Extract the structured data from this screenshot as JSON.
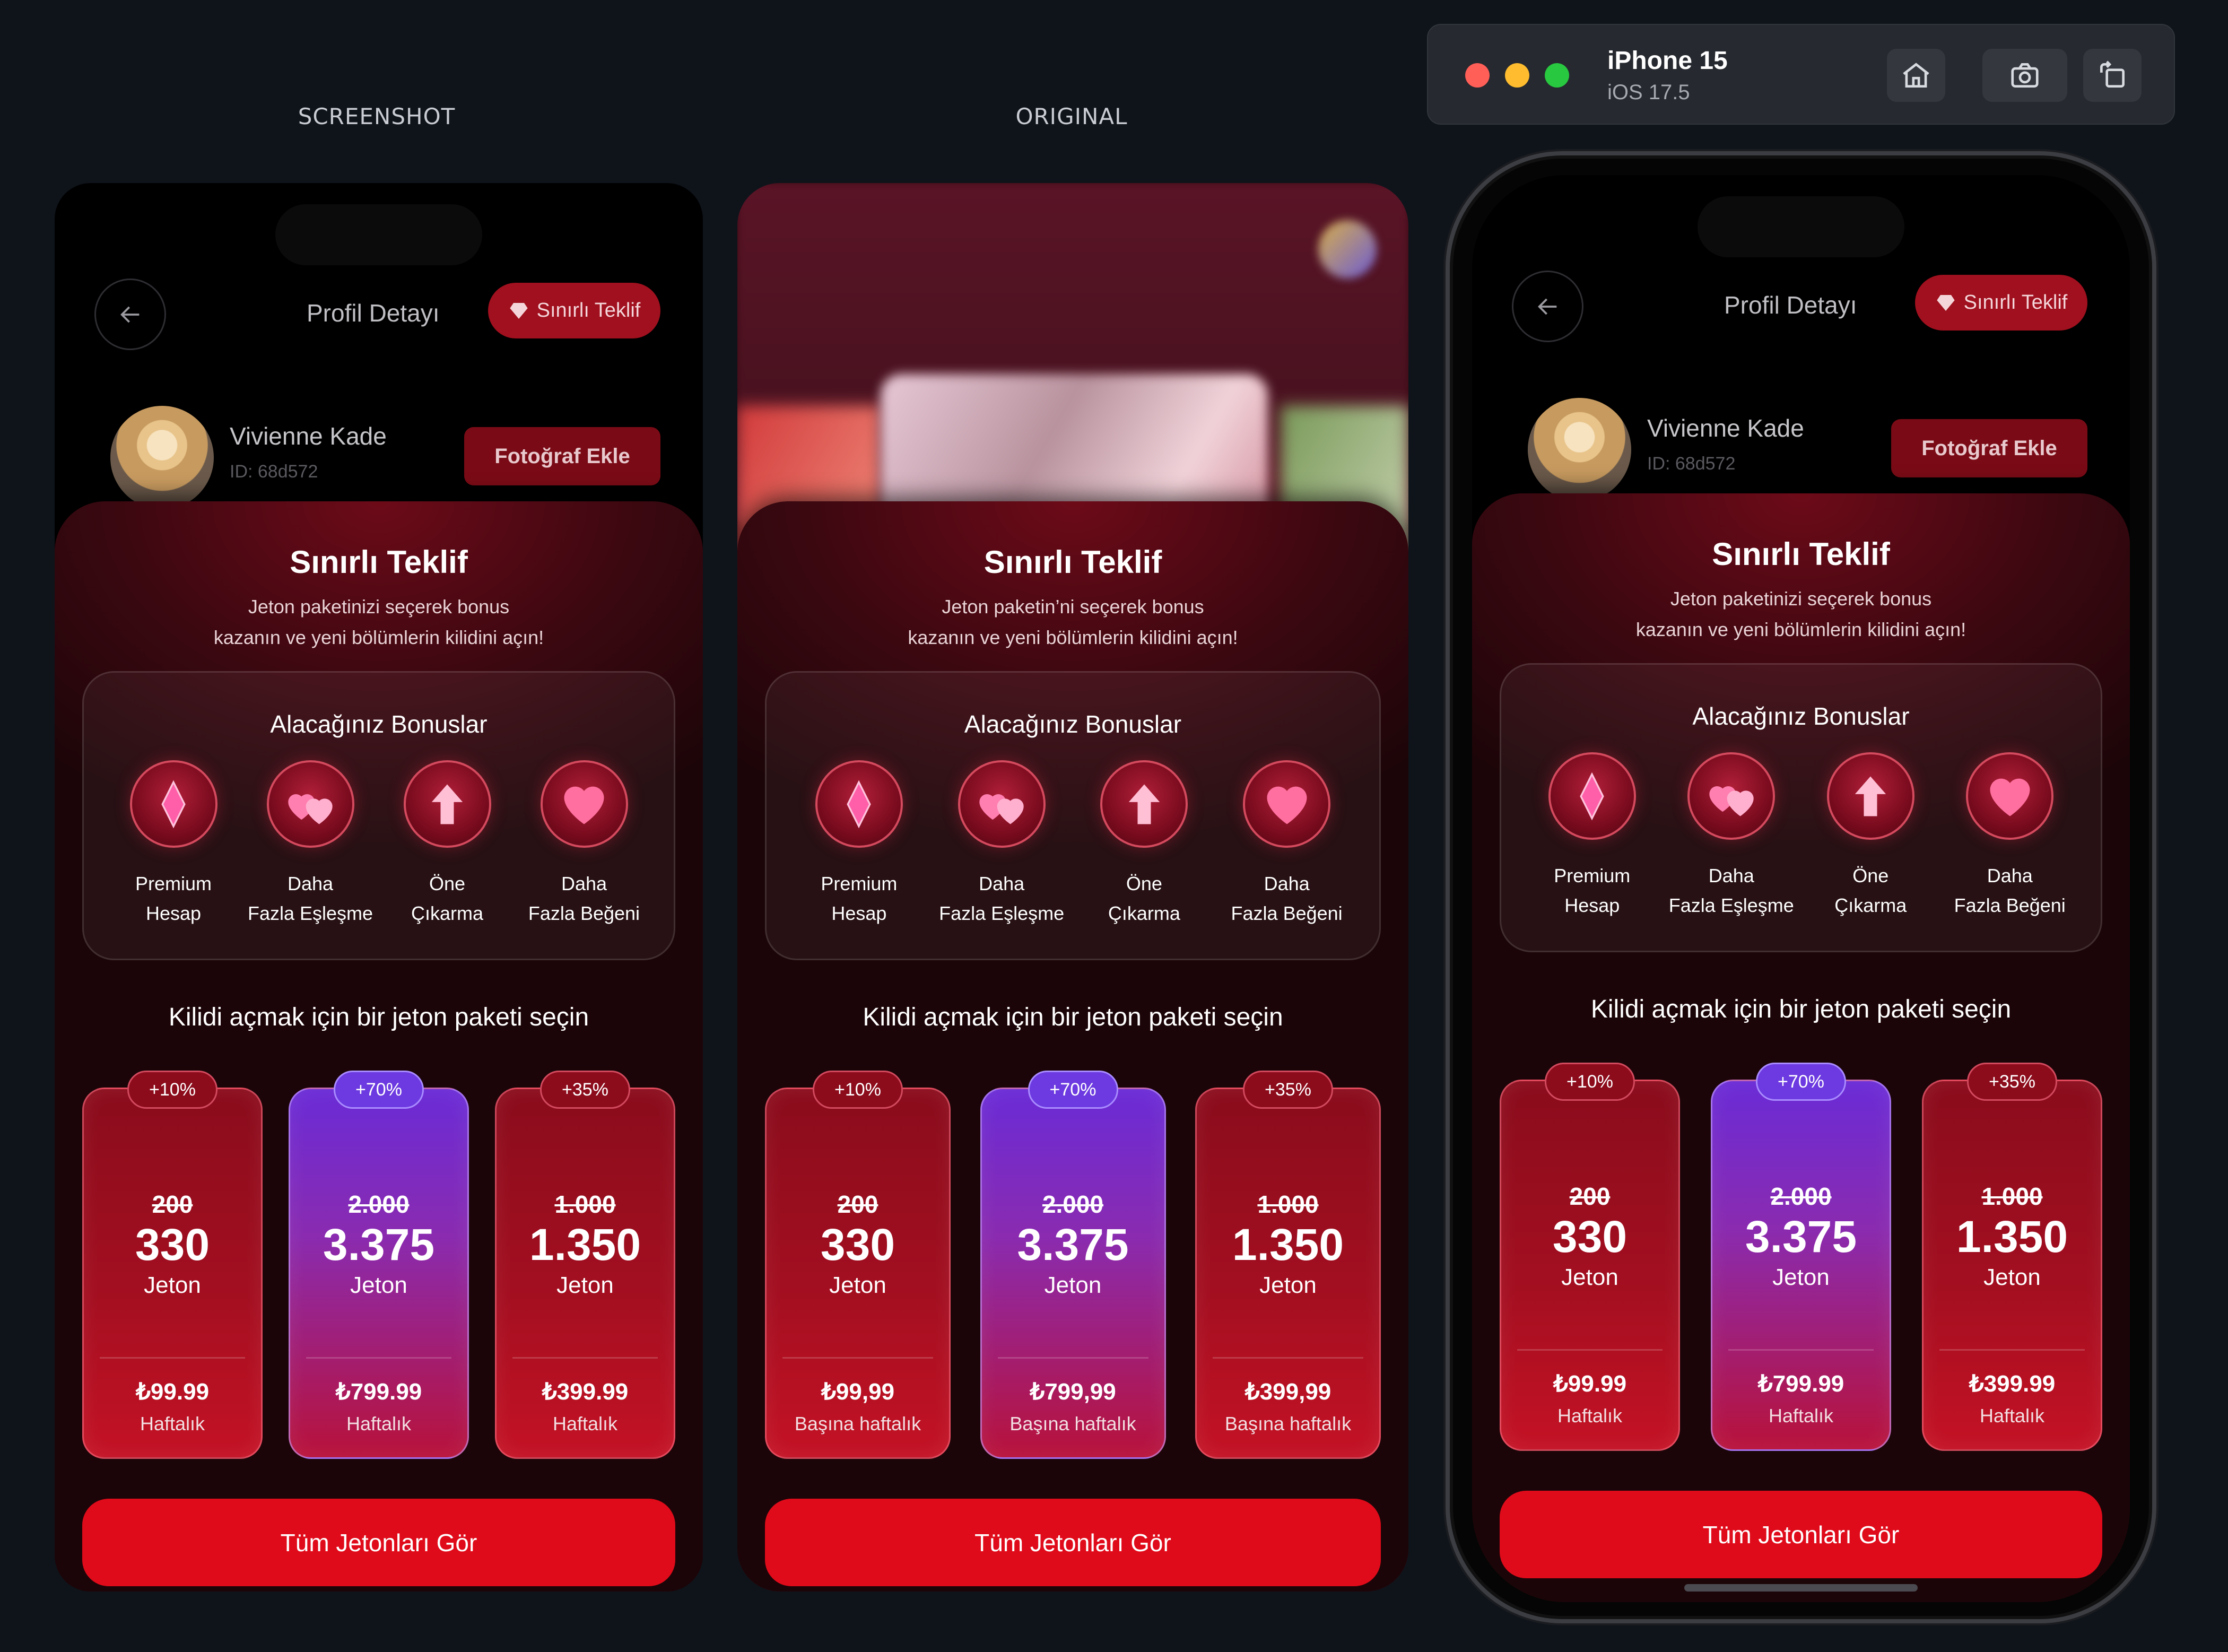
{
  "labels": {
    "screenshot": "SCREENSHOT",
    "original": "ORIGINAL"
  },
  "simulator": {
    "device": "iPhone 15",
    "os": "iOS 17.5",
    "icons": [
      "home-icon",
      "screenshot-icon",
      "rotate-icon"
    ]
  },
  "header": {
    "title": "Profil Detayı",
    "limited_offer": "Sınırlı Teklif"
  },
  "profile": {
    "name": "Vivienne Kade",
    "id": "ID: 68d572",
    "add_photo": "Fotoğraf Ekle"
  },
  "screens": [
    {
      "title": "Sınırlı Teklif",
      "subtitle_line1": "Jeton paketinizi seçerek bonus",
      "subtitle_line2": "kazanın ve yeni bölümlerin kilidini açın!",
      "bonus_title": "Alacağınız Bonuslar",
      "bonuses": [
        {
          "l1": "Premium",
          "l2": "Hesap"
        },
        {
          "l1": "Daha",
          "l2": "Fazla Eşleşme"
        },
        {
          "l1": "Öne",
          "l2": "Çıkarma"
        },
        {
          "l1": "Daha",
          "l2": "Fazla Beğeni"
        }
      ],
      "pick_title": "Kilidi açmak için bir jeton paketi seçin",
      "packs": [
        {
          "badge": "+10%",
          "old": "200",
          "value": "330",
          "unit": "Jeton",
          "price": "₺99.99",
          "period": "Haftalık"
        },
        {
          "badge": "+70%",
          "old": "2.000",
          "value": "3.375",
          "unit": "Jeton",
          "price": "₺799.99",
          "period": "Haftalık"
        },
        {
          "badge": "+35%",
          "old": "1.000",
          "value": "1.350",
          "unit": "Jeton",
          "price": "₺399.99",
          "period": "Haftalık"
        }
      ],
      "cta": "Tüm Jetonları Gör"
    },
    {
      "title": "Sınırlı Teklif",
      "subtitle_line1": "Jeton paketin’ni seçerek bonus",
      "subtitle_line2": "kazanın ve yeni bölümlerin kilidini açın!",
      "bonus_title": "Alacağınız Bonuslar",
      "bonuses": [
        {
          "l1": "Premium",
          "l2": "Hesap"
        },
        {
          "l1": "Daha",
          "l2": "Fazla Eşleşme"
        },
        {
          "l1": "Öne",
          "l2": "Çıkarma"
        },
        {
          "l1": "Daha",
          "l2": "Fazla Beğeni"
        }
      ],
      "pick_title": "Kilidi açmak için bir jeton paketi seçin",
      "packs": [
        {
          "badge": "+10%",
          "old": "200",
          "value": "330",
          "unit": "Jeton",
          "price": "₺99,99",
          "period": "Başına haftalık"
        },
        {
          "badge": "+70%",
          "old": "2.000",
          "value": "3.375",
          "unit": "Jeton",
          "price": "₺799,99",
          "period": "Başına haftalık"
        },
        {
          "badge": "+35%",
          "old": "1.000",
          "value": "1.350",
          "unit": "Jeton",
          "price": "₺399,99",
          "period": "Başına haftalık"
        }
      ],
      "cta": "Tüm Jetonları Gör"
    },
    {
      "title": "Sınırlı Teklif",
      "subtitle_line1": "Jeton paketinizi seçerek bonus",
      "subtitle_line2": "kazanın ve yeni bölümlerin kilidini açın!",
      "bonus_title": "Alacağınız Bonuslar",
      "bonuses": [
        {
          "l1": "Premium",
          "l2": "Hesap"
        },
        {
          "l1": "Daha",
          "l2": "Fazla Eşleşme"
        },
        {
          "l1": "Öne",
          "l2": "Çıkarma"
        },
        {
          "l1": "Daha",
          "l2": "Fazla Beğeni"
        }
      ],
      "pick_title": "Kilidi açmak için bir jeton paketi seçin",
      "packs": [
        {
          "badge": "+10%",
          "old": "200",
          "value": "330",
          "unit": "Jeton",
          "price": "₺99.99",
          "period": "Haftalık"
        },
        {
          "badge": "+70%",
          "old": "2.000",
          "value": "3.375",
          "unit": "Jeton",
          "price": "₺799.99",
          "period": "Haftalık"
        },
        {
          "badge": "+35%",
          "old": "1.000",
          "value": "1.350",
          "unit": "Jeton",
          "price": "₺399.99",
          "period": "Haftalık"
        }
      ],
      "cta": "Tüm Jetonları Gör"
    }
  ],
  "colors": {
    "accent": "#e00b1a",
    "featured": "#6c3ae0",
    "background": "#0f141b"
  },
  "bonus_icons": [
    "gem-icon",
    "hearts-icon",
    "boost-arrow-icon",
    "heart-icon"
  ]
}
